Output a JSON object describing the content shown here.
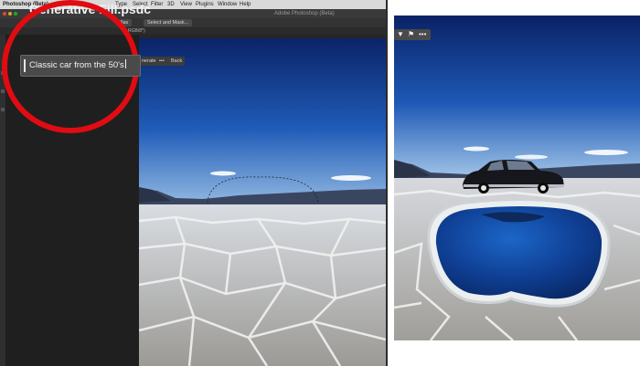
{
  "menubar": {
    "app_name": "Photoshop (Beta)",
    "items": [
      "Type",
      "Select",
      "Filter",
      "3D",
      "View",
      "Plugins",
      "Window",
      "Help"
    ]
  },
  "window": {
    "title": "Adobe Photoshop (Beta)"
  },
  "document": {
    "filename": "Generative Fill.psdc"
  },
  "options_bar": {
    "button_1": "llas",
    "button_2": "Select and Mask..."
  },
  "tab": {
    "label": "RGB/8*)"
  },
  "generative_fill": {
    "prompt_value": "Classic car from the 50's",
    "generate_label": "nerate",
    "more_label": "•••",
    "back_label": "Back"
  },
  "result_toolbar": {
    "thumbs_down_icon": "thumbs-down-icon",
    "flag_icon": "flag-icon",
    "more_label": "•••"
  },
  "colors": {
    "highlight_circle": "#e00c12",
    "ui_dark": "#262626",
    "sky_top": "#0d2a72"
  }
}
